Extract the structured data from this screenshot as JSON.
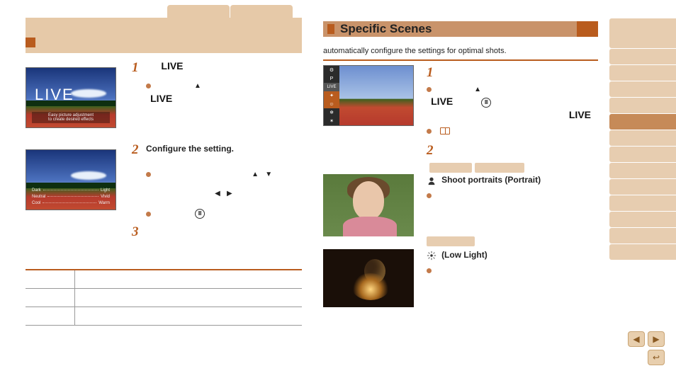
{
  "left": {
    "screenshot1": {
      "live_overlay": "LIVE",
      "subtitle_line1": "Easy picture adjustment",
      "subtitle_line2": "to create desired effects"
    },
    "step1": {
      "num": "1",
      "live1": "LIVE",
      "live2": "LIVE"
    },
    "screenshot2_labels": {
      "row1_l": "Dark",
      "row1_r": "Light",
      "row2_l": "Neutral",
      "row2_r": "Vivid",
      "row3_l": "Cool",
      "row3_r": "Warm"
    },
    "step2": {
      "num": "2",
      "title": "Configure the setting."
    },
    "step3": {
      "num": "3"
    },
    "func_label": "FUNC\nSET"
  },
  "right": {
    "title": "Specific Scenes",
    "subtitle": "automatically configure the settings for optimal shots.",
    "step1": {
      "num": "1",
      "live1": "LIVE",
      "live2": "LIVE",
      "func_label": "FUNC\nSET"
    },
    "step2": {
      "num": "2"
    },
    "portrait_title": "Shoot portraits (Portrait)",
    "lowlight_title": "(Low Light)"
  },
  "sidebar_tabs": 12,
  "nav": {
    "prev": "◀",
    "next": "▶",
    "return": "↩"
  }
}
